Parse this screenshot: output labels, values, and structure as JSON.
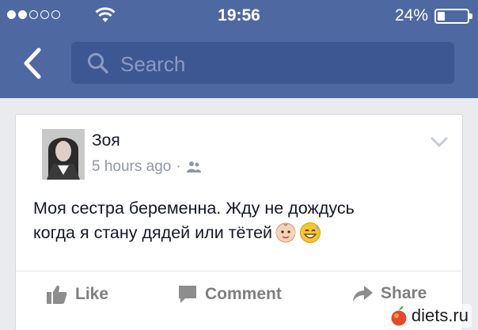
{
  "statusbar": {
    "time": "19:56",
    "battery_text": "24%",
    "battery_level": 0.24,
    "signal_bars_filled": 2,
    "signal_bars_total": 5
  },
  "navbar": {
    "search_placeholder": "Search"
  },
  "post": {
    "author": "Зоя",
    "timestamp": "5 hours ago",
    "separator": "·",
    "audience_icon": "friends-icon",
    "text_line1": "Моя сестра беременна. Жду не дождусь",
    "text_line2": "когда я стану дядей или тётей",
    "emojis": [
      "baby-face-icon",
      "grinning-sweat-icon"
    ]
  },
  "actions": {
    "like_label": "Like",
    "comment_label": "Comment",
    "share_label": "Share"
  },
  "watermark": {
    "text": "diets.ru"
  },
  "colors": {
    "brand": "#4e69a2",
    "search_bg": "#3d5793",
    "page_bg": "#e9ebee"
  }
}
